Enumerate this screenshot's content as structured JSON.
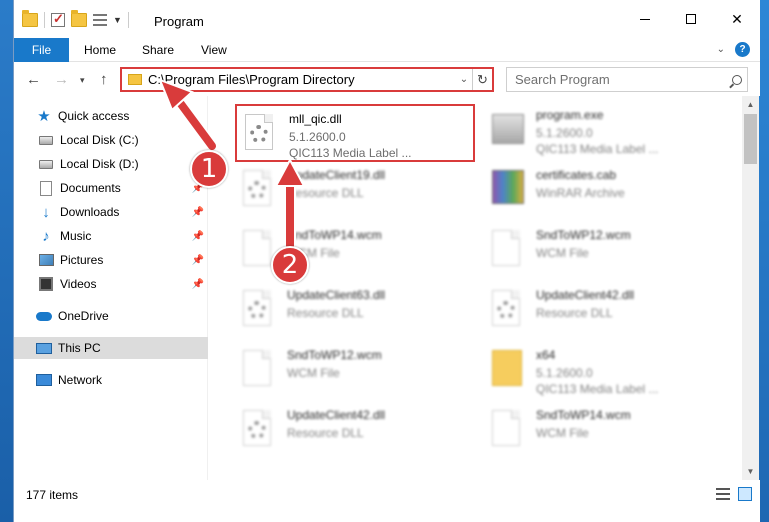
{
  "window": {
    "title": "Program",
    "controls": {
      "minimize": "",
      "maximize": "",
      "close": "✕"
    }
  },
  "ribbon": {
    "tabs": [
      "File",
      "Home",
      "Share",
      "View"
    ]
  },
  "address_bar": {
    "path": "C:\\Program Files\\Program Directory",
    "search_placeholder": "Search Program"
  },
  "nav_pane": {
    "items": [
      {
        "label": "Quick access",
        "icon": "star-icon"
      },
      {
        "label": "Local Disk (C:)",
        "icon": "disk-icon"
      },
      {
        "label": "Local Disk (D:)",
        "icon": "disk-icon"
      },
      {
        "label": "Documents",
        "icon": "documents-icon"
      },
      {
        "label": "Downloads",
        "icon": "downloads-icon"
      },
      {
        "label": "Music",
        "icon": "music-icon"
      },
      {
        "label": "Pictures",
        "icon": "pictures-icon"
      },
      {
        "label": "Videos",
        "icon": "videos-icon"
      },
      {
        "label": "OneDrive",
        "icon": "onedrive-icon"
      },
      {
        "label": "This PC",
        "icon": "this-pc-icon"
      },
      {
        "label": "Network",
        "icon": "network-icon"
      }
    ]
  },
  "files": [
    {
      "name": "mll_qic.dll",
      "line1": "5.1.2600.0",
      "line2": "QIC113 Media Label ...",
      "icon": "dll-icon"
    },
    {
      "name": "program.exe",
      "line1": "5.1.2600.0",
      "line2": "QIC113 Media Label ...",
      "icon": "exe-icon"
    },
    {
      "name": "UpdateClient19.dll",
      "line1": "Resource DLL",
      "line2": "",
      "icon": "dll-icon"
    },
    {
      "name": "certificates.cab",
      "line1": "WinRAR Archive",
      "line2": "",
      "icon": "winrar-icon"
    },
    {
      "name": "SndToWP14.wcm",
      "line1": "WCM File",
      "line2": "",
      "icon": "file-icon"
    },
    {
      "name": "SndToWP12.wcm",
      "line1": "WCM File",
      "line2": "",
      "icon": "file-icon"
    },
    {
      "name": "UpdateClient63.dll",
      "line1": "Resource DLL",
      "line2": "",
      "icon": "dll-icon"
    },
    {
      "name": "UpdateClient42.dll",
      "line1": "Resource DLL",
      "line2": "",
      "icon": "dll-icon"
    },
    {
      "name": "SndToWP12.wcm",
      "line1": "WCM File",
      "line2": "",
      "icon": "file-icon"
    },
    {
      "name": "x64",
      "line1": "5.1.2600.0",
      "line2": "QIC113 Media Label ...",
      "icon": "folder-icon"
    },
    {
      "name": "UpdateClient42.dll",
      "line1": "Resource DLL",
      "line2": "",
      "icon": "dll-icon"
    },
    {
      "name": "SndToWP14.wcm",
      "line1": "WCM File",
      "line2": "",
      "icon": "file-icon"
    }
  ],
  "status": {
    "item_count": "177 items"
  },
  "annotations": {
    "step1": "1",
    "step2": "2",
    "color": "#d93b3b"
  },
  "colors": {
    "accent": "#1979ca",
    "highlight": "#d93b3b"
  }
}
